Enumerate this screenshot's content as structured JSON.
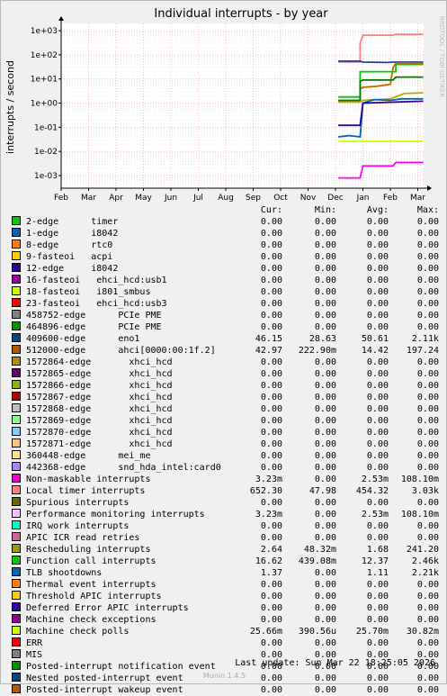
{
  "chart_data": {
    "type": "line",
    "title": "Individual interrupts - by year",
    "ylabel": "interrupts / second",
    "watermark": "RRDTOOL / TOBI OETIKER",
    "y_scale": "log",
    "ylim": [
      0.0003,
      2000
    ],
    "y_ticks": [
      {
        "value": 1000,
        "label": "1e+03"
      },
      {
        "value": 100,
        "label": "1e+02"
      },
      {
        "value": 10,
        "label": "1e+01"
      },
      {
        "value": 1,
        "label": "1e+00"
      },
      {
        "value": 0.1,
        "label": "1e-01"
      },
      {
        "value": 0.01,
        "label": "1e-02"
      },
      {
        "value": 0.001,
        "label": "1e-03"
      }
    ],
    "x_ticks": [
      "Feb",
      "Mar",
      "Apr",
      "May",
      "Jun",
      "Jul",
      "Aug",
      "Sep",
      "Oct",
      "Nov",
      "Dec",
      "Jan",
      "Feb",
      "Mar"
    ],
    "x_range_months": [
      0,
      13.3
    ],
    "grid": true,
    "colors": {
      "background": "#f0f0f0",
      "canvas": "#ffffff",
      "major_grid": "#f0a0a0",
      "minor_grid": "#d8d8d8",
      "axis": "#000000"
    },
    "series": [
      {
        "name": "Local timer interrupts",
        "color": "#FF8080",
        "points": [
          [
            10.1,
            50
          ],
          [
            10.9,
            50
          ],
          [
            10.9,
            300
          ],
          [
            11.0,
            650
          ],
          [
            12.1,
            650
          ],
          [
            12.2,
            700
          ],
          [
            13.2,
            700
          ]
        ]
      },
      {
        "name": "409600-edge eno1",
        "color": "#333399",
        "points": [
          [
            10.1,
            55
          ],
          [
            10.9,
            55
          ],
          [
            11.0,
            50
          ],
          [
            11.9,
            48
          ],
          [
            12.1,
            50
          ],
          [
            13.2,
            50
          ]
        ]
      },
      {
        "name": "8-edge rtc0",
        "color": "#CC6600",
        "points": [
          [
            10.1,
            1.2
          ],
          [
            10.9,
            1.2
          ],
          [
            10.9,
            4
          ],
          [
            11.0,
            4.5
          ],
          [
            11.5,
            5
          ],
          [
            12.0,
            6
          ],
          [
            12.1,
            30
          ],
          [
            12.2,
            45
          ],
          [
            13.2,
            45
          ]
        ]
      },
      {
        "name": "Function call interrupts",
        "color": "#00CC00",
        "points": [
          [
            10.1,
            1.8
          ],
          [
            10.9,
            1.8
          ],
          [
            10.9,
            20
          ],
          [
            11.0,
            20
          ],
          [
            12.2,
            20
          ],
          [
            12.2,
            40
          ],
          [
            13.2,
            40
          ]
        ]
      },
      {
        "name": "512000-edge ahci[0000:00:1f.2]",
        "color": "#007700",
        "points": [
          [
            10.1,
            1.3
          ],
          [
            10.9,
            1.3
          ],
          [
            10.9,
            8
          ],
          [
            11.0,
            9
          ],
          [
            12.1,
            9
          ],
          [
            12.2,
            12
          ],
          [
            13.2,
            12
          ]
        ]
      },
      {
        "name": "Rescheduling interrupts",
        "color": "#BBAA00",
        "points": [
          [
            10.1,
            1.1
          ],
          [
            10.9,
            1.1
          ],
          [
            11.0,
            1.3
          ],
          [
            12.0,
            1.5
          ],
          [
            12.5,
            2.5
          ],
          [
            13.2,
            2.7
          ]
        ]
      },
      {
        "name": "1-edge i8042",
        "color": "#0066B3",
        "points": [
          [
            10.1,
            0.04
          ],
          [
            10.5,
            0.045
          ],
          [
            10.9,
            0.04
          ],
          [
            11.0,
            1.0
          ],
          [
            11.4,
            1.4
          ],
          [
            12.0,
            1.3
          ],
          [
            12.4,
            1.5
          ],
          [
            13.2,
            1.5
          ]
        ]
      },
      {
        "name": "TLB shootdowns",
        "color": "#330099",
        "points": [
          [
            10.1,
            0.12
          ],
          [
            10.9,
            0.12
          ],
          [
            11.0,
            1.0
          ],
          [
            13.2,
            1.2
          ]
        ]
      },
      {
        "name": "Machine check polls",
        "color": "#CCFF00",
        "points": [
          [
            10.1,
            0.026
          ],
          [
            13.2,
            0.026
          ]
        ]
      },
      {
        "name": "Non-maskable interrupts",
        "color": "#FF00FF",
        "points": [
          [
            10.1,
            0.0008
          ],
          [
            10.9,
            0.0008
          ],
          [
            11.0,
            0.0025
          ],
          [
            12.1,
            0.0025
          ],
          [
            12.2,
            0.0035
          ],
          [
            13.2,
            0.0035
          ]
        ]
      }
    ],
    "legend_header": {
      "cur": "Cur:",
      "min": "Min:",
      "avg": "Avg:",
      "max": "Max:"
    },
    "legend": [
      {
        "color": "#00CC00",
        "label": "2-edge      timer",
        "cur": "0.00",
        "min": "0.00",
        "avg": "0.00",
        "max": "0.00"
      },
      {
        "color": "#0066B3",
        "label": "1-edge      i8042",
        "cur": "0.00",
        "min": "0.00",
        "avg": "0.00",
        "max": "0.00"
      },
      {
        "color": "#FF8000",
        "label": "8-edge      rtc0",
        "cur": "0.00",
        "min": "0.00",
        "avg": "0.00",
        "max": "0.00"
      },
      {
        "color": "#FFCC00",
        "label": "9-fasteoi   acpi",
        "cur": "0.00",
        "min": "0.00",
        "avg": "0.00",
        "max": "0.00"
      },
      {
        "color": "#330099",
        "label": "12-edge     i8042",
        "cur": "0.00",
        "min": "0.00",
        "avg": "0.00",
        "max": "0.00"
      },
      {
        "color": "#990099",
        "label": "16-fasteoi   ehci_hcd:usb1",
        "cur": "0.00",
        "min": "0.00",
        "avg": "0.00",
        "max": "0.00"
      },
      {
        "color": "#CCFF00",
        "label": "18-fasteoi   i801_smbus",
        "cur": "0.00",
        "min": "0.00",
        "avg": "0.00",
        "max": "0.00"
      },
      {
        "color": "#FF0000",
        "label": "23-fasteoi   ehci_hcd:usb3",
        "cur": "0.00",
        "min": "0.00",
        "avg": "0.00",
        "max": "0.00"
      },
      {
        "color": "#808080",
        "label": "458752-edge      PCIe PME",
        "cur": "0.00",
        "min": "0.00",
        "avg": "0.00",
        "max": "0.00"
      },
      {
        "color": "#008F00",
        "label": "464896-edge      PCIe PME",
        "cur": "0.00",
        "min": "0.00",
        "avg": "0.00",
        "max": "0.00"
      },
      {
        "color": "#00487D",
        "label": "409600-edge      eno1",
        "cur": "46.15",
        "min": "28.63",
        "avg": "50.61",
        "max": "2.11k"
      },
      {
        "color": "#B35A00",
        "label": "512000-edge      ahci[0000:00:1f.2]",
        "cur": "42.97",
        "min": "222.90m",
        "avg": "14.42",
        "max": "197.24"
      },
      {
        "color": "#B38F00",
        "label": "1572864-edge       xhci_hcd",
        "cur": "0.00",
        "min": "0.00",
        "avg": "0.00",
        "max": "0.00"
      },
      {
        "color": "#6B006B",
        "label": "1572865-edge       xhci_hcd",
        "cur": "0.00",
        "min": "0.00",
        "avg": "0.00",
        "max": "0.00"
      },
      {
        "color": "#8FB300",
        "label": "1572866-edge       xhci_hcd",
        "cur": "0.00",
        "min": "0.00",
        "avg": "0.00",
        "max": "0.00"
      },
      {
        "color": "#B30000",
        "label": "1572867-edge       xhci_hcd",
        "cur": "0.00",
        "min": "0.00",
        "avg": "0.00",
        "max": "0.00"
      },
      {
        "color": "#BEBEBE",
        "label": "1572868-edge       xhci_hcd",
        "cur": "0.00",
        "min": "0.00",
        "avg": "0.00",
        "max": "0.00"
      },
      {
        "color": "#80FF80",
        "label": "1572869-edge       xhci_hcd",
        "cur": "0.00",
        "min": "0.00",
        "avg": "0.00",
        "max": "0.00"
      },
      {
        "color": "#80C9FF",
        "label": "1572870-edge       xhci_hcd",
        "cur": "0.00",
        "min": "0.00",
        "avg": "0.00",
        "max": "0.00"
      },
      {
        "color": "#FFC080",
        "label": "1572871-edge       xhci_hcd",
        "cur": "0.00",
        "min": "0.00",
        "avg": "0.00",
        "max": "0.00"
      },
      {
        "color": "#FFE680",
        "label": "360448-edge      mei_me",
        "cur": "0.00",
        "min": "0.00",
        "avg": "0.00",
        "max": "0.00"
      },
      {
        "color": "#AA80FF",
        "label": "442368-edge      snd_hda_intel:card0",
        "cur": "0.00",
        "min": "0.00",
        "avg": "0.00",
        "max": "0.00"
      },
      {
        "color": "#EE00CC",
        "label": "Non-maskable interrupts",
        "cur": "3.23m",
        "min": "0.00",
        "avg": "2.53m",
        "max": "108.10m"
      },
      {
        "color": "#FF8080",
        "label": "Local timer interrupts",
        "cur": "652.30",
        "min": "47.98",
        "avg": "454.32",
        "max": "3.03k"
      },
      {
        "color": "#666600",
        "label": "Spurious interrupts",
        "cur": "0.00",
        "min": "0.00",
        "avg": "0.00",
        "max": "0.00"
      },
      {
        "color": "#FFBFFF",
        "label": "Performance monitoring interrupts",
        "cur": "3.23m",
        "min": "0.00",
        "avg": "2.53m",
        "max": "108.10m"
      },
      {
        "color": "#00FFCC",
        "label": "IRQ work interrupts",
        "cur": "0.00",
        "min": "0.00",
        "avg": "0.00",
        "max": "0.00"
      },
      {
        "color": "#CC6699",
        "label": "APIC ICR read retries",
        "cur": "0.00",
        "min": "0.00",
        "avg": "0.00",
        "max": "0.00"
      },
      {
        "color": "#999900",
        "label": "Rescheduling interrupts",
        "cur": "2.64",
        "min": "48.32m",
        "avg": "1.68",
        "max": "241.20"
      },
      {
        "color": "#00CC00",
        "label": "Function call interrupts",
        "cur": "16.62",
        "min": "439.08m",
        "avg": "12.37",
        "max": "2.46k"
      },
      {
        "color": "#0066B3",
        "label": "TLB shootdowns",
        "cur": "1.37",
        "min": "0.00",
        "avg": "1.11",
        "max": "2.21k"
      },
      {
        "color": "#FF8000",
        "label": "Thermal event interrupts",
        "cur": "0.00",
        "min": "0.00",
        "avg": "0.00",
        "max": "0.00"
      },
      {
        "color": "#FFCC00",
        "label": "Threshold APIC interrupts",
        "cur": "0.00",
        "min": "0.00",
        "avg": "0.00",
        "max": "0.00"
      },
      {
        "color": "#330099",
        "label": "Deferred Error APIC interrupts",
        "cur": "0.00",
        "min": "0.00",
        "avg": "0.00",
        "max": "0.00"
      },
      {
        "color": "#990099",
        "label": "Machine check exceptions",
        "cur": "0.00",
        "min": "0.00",
        "avg": "0.00",
        "max": "0.00"
      },
      {
        "color": "#CCFF00",
        "label": "Machine check polls",
        "cur": "25.66m",
        "min": "390.56u",
        "avg": "25.70m",
        "max": "30.82m"
      },
      {
        "color": "#FF0000",
        "label": "ERR",
        "cur": "0.00",
        "min": "0.00",
        "avg": "0.00",
        "max": "0.00"
      },
      {
        "color": "#808080",
        "label": "MIS",
        "cur": "0.00",
        "min": "0.00",
        "avg": "0.00",
        "max": "0.00"
      },
      {
        "color": "#008F00",
        "label": "Posted-interrupt notification event",
        "cur": "0.00",
        "min": "0.00",
        "avg": "0.00",
        "max": "0.00"
      },
      {
        "color": "#00487D",
        "label": "Nested posted-interrupt event",
        "cur": "0.00",
        "min": "0.00",
        "avg": "0.00",
        "max": "0.00"
      },
      {
        "color": "#B35A00",
        "label": "Posted-interrupt wakeup event",
        "cur": "0.00",
        "min": "0.00",
        "avg": "0.00",
        "max": "0.00"
      }
    ]
  },
  "footer": {
    "last_update": "Last update:  Sun Mar 22 18:25:05 2026",
    "munin_version": "Munin 1.4.5"
  }
}
